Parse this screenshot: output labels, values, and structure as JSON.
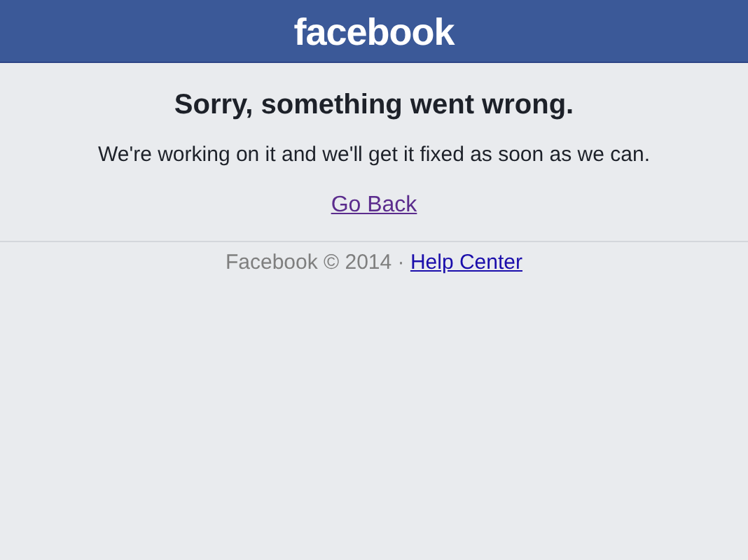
{
  "header": {
    "logo": "facebook"
  },
  "error": {
    "title": "Sorry, something went wrong.",
    "message": "We're working on it and we'll get it fixed as soon as we can.",
    "link": {
      "label": "Go Back",
      "visited": true
    }
  },
  "footer": {
    "text": "Facebook © 2014 · ",
    "link": {
      "label": "Help Center",
      "visited": false
    }
  }
}
